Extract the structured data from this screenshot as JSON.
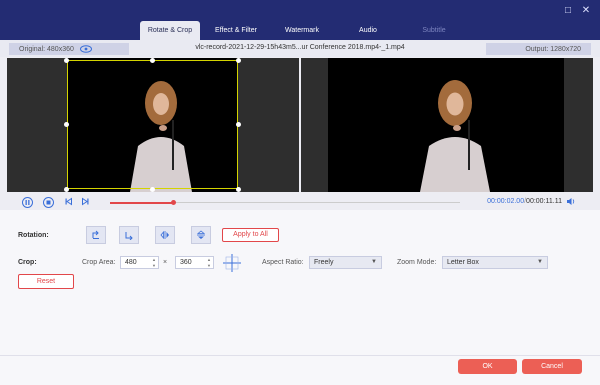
{
  "window": {
    "minimize_glyph": "□",
    "close_glyph": "✕"
  },
  "tabs": [
    {
      "label": "Rotate & Crop",
      "active": true
    },
    {
      "label": "Effect & Filter",
      "active": false
    },
    {
      "label": "Watermark",
      "active": false
    },
    {
      "label": "Audio",
      "active": false
    },
    {
      "label": "Subtitle",
      "active": false,
      "disabled": true
    }
  ],
  "info": {
    "original": "Original: 480x360",
    "filename": "vlc-record-2021-12-29-15h43m5...ur Conference 2018.mp4-_1.mp4",
    "output": "Output: 1280x720"
  },
  "player": {
    "progress_fraction": 0.18,
    "current_time": "00:00:02.00",
    "separator": "/",
    "duration": "00:00:11.11"
  },
  "rotation": {
    "label": "Rotation:",
    "buttons": [
      "rotate-left-icon",
      "rotate-right-icon",
      "flip-horizontal-icon",
      "flip-vertical-icon"
    ],
    "apply_all": "Apply to All"
  },
  "crop": {
    "label": "Crop:",
    "area_label": "Crop Area:",
    "width": "480",
    "times": "×",
    "height": "360",
    "aspect_label": "Aspect Ratio:",
    "aspect_value": "Freely",
    "zoom_label": "Zoom Mode:",
    "zoom_value": "Letter Box",
    "reset": "Reset"
  },
  "footer": {
    "ok": "OK",
    "cancel": "Cancel"
  },
  "colors": {
    "accent": "#3a6fd9",
    "danger": "#e2474a",
    "titlebar": "#232c73"
  }
}
